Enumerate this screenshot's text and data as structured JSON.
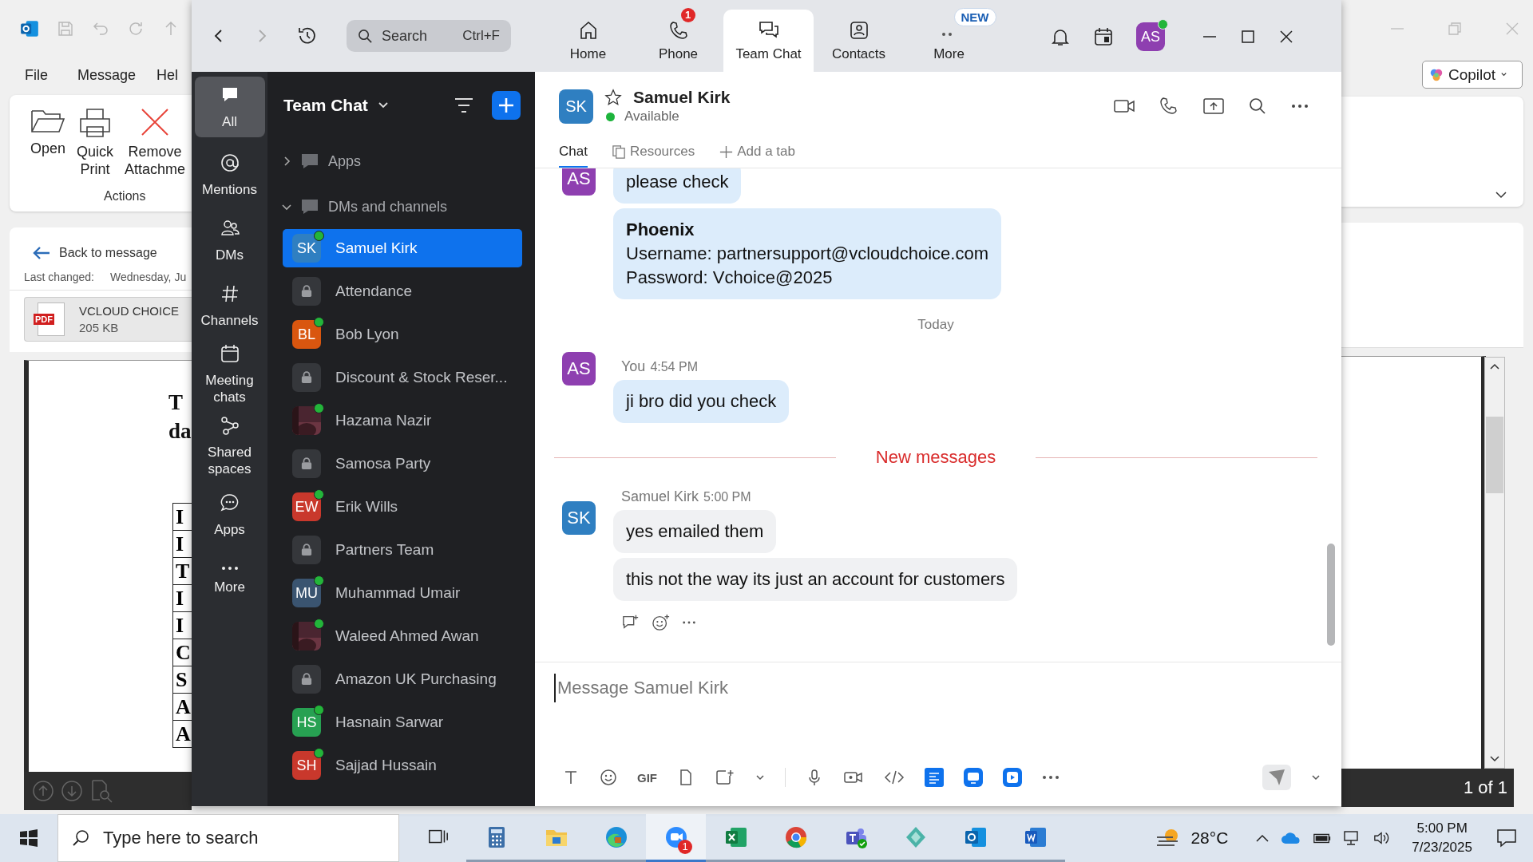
{
  "outlook": {
    "menu": [
      "File",
      "Message",
      "Hel"
    ],
    "ribbon": {
      "buttons": [
        {
          "kind": "open",
          "lines": [
            "Open"
          ]
        },
        {
          "kind": "print",
          "lines": [
            "Quick",
            "Print"
          ]
        },
        {
          "kind": "remove",
          "lines": [
            "Remove",
            "Attachme"
          ]
        }
      ],
      "group_label": "Actions"
    },
    "copilot": "Copilot",
    "back_link": "Back to message",
    "last_changed_label": "Last changed:",
    "last_changed_value": "Wednesday, Ju",
    "attachment": {
      "badge": "PDF",
      "name": "VCLOUD CHOICE",
      "size": "205 KB"
    },
    "document": {
      "heading_lines": [
        "T",
        "da"
      ],
      "table_cells": [
        "I",
        "I",
        "T",
        "I",
        "I",
        "C",
        "S",
        "A",
        "A"
      ]
    },
    "page_indicator": "1 of 1"
  },
  "zoom": {
    "search": {
      "placeholder": "Search",
      "shortcut": "Ctrl+F"
    },
    "nav_tabs": [
      {
        "kind": "home",
        "label": "Home",
        "selected": false
      },
      {
        "kind": "phone",
        "label": "Phone",
        "selected": false,
        "badge": "1"
      },
      {
        "kind": "chat",
        "label": "Team Chat",
        "selected": true
      },
      {
        "kind": "contacts",
        "label": "Contacts",
        "selected": false
      },
      {
        "kind": "more",
        "label": "More",
        "selected": false,
        "tag": "NEW"
      }
    ],
    "user": {
      "initials": "AS",
      "online": true
    },
    "sidebar": [
      {
        "kind": "chat",
        "label": "All",
        "selected": true
      },
      {
        "kind": "at",
        "label": "Mentions",
        "selected": false
      },
      {
        "kind": "people",
        "label": "DMs",
        "selected": false
      },
      {
        "kind": "hash",
        "label": "Channels",
        "selected": false
      },
      {
        "kind": "calendar",
        "label": "Meeting chats",
        "selected": false
      },
      {
        "kind": "share",
        "label": "Shared spaces",
        "selected": false
      },
      {
        "kind": "bubble",
        "label": "Apps",
        "selected": false
      },
      {
        "kind": "dots",
        "label": "More",
        "selected": false
      }
    ],
    "list_title": "Team Chat",
    "sections": [
      {
        "label": "Apps",
        "expanded": false
      },
      {
        "label": "DMs and channels",
        "expanded": true
      }
    ],
    "chats": [
      {
        "kind": "person",
        "name": "Samuel Kirk",
        "initials": "SK",
        "color": "#2f7fc1",
        "online": true,
        "selected": true
      },
      {
        "kind": "channel",
        "name": "Attendance",
        "selected": false
      },
      {
        "kind": "person",
        "name": "Bob Lyon",
        "initials": "BL",
        "color": "#d9560f",
        "online": true,
        "selected": false
      },
      {
        "kind": "channel",
        "name": "Discount & Stock Reser...",
        "selected": false
      },
      {
        "name": "Hazama Nazir",
        "online": true,
        "selected": false
      },
      {
        "kind": "channel",
        "name": "Samosa Party",
        "selected": false
      },
      {
        "kind": "person",
        "name": "Erik Wills",
        "initials": "EW",
        "color": "#c9382c",
        "online": true,
        "selected": false
      },
      {
        "kind": "channel",
        "name": "Partners Team",
        "selected": false
      },
      {
        "kind": "person",
        "name": "Muhammad Umair",
        "initials": "MU",
        "color": "#3a5470",
        "online": true,
        "selected": false
      },
      {
        "name": "Waleed Ahmed Awan",
        "online": true,
        "selected": false
      },
      {
        "kind": "channel",
        "name": "Amazon UK Purchasing",
        "selected": false
      },
      {
        "kind": "person",
        "name": "Hasnain Sarwar",
        "initials": "HS",
        "color": "#27a152",
        "online": true,
        "selected": false
      },
      {
        "kind": "person",
        "name": "Sajjad Hussain",
        "initials": "SH",
        "color": "#c9382c",
        "online": true,
        "selected": false
      }
    ],
    "chat_header": {
      "initials": "SK",
      "name": "Samuel Kirk",
      "status": "Available",
      "online": true
    },
    "chat_tabs": [
      {
        "kind": "plain",
        "label": "Chat",
        "selected": true
      },
      {
        "kind": "files",
        "label": "Resources",
        "selected": false
      },
      {
        "kind": "add",
        "label": "Add a tab",
        "selected": false
      }
    ],
    "messages": [
      {
        "kind": "group",
        "initials": "AS",
        "mine": true,
        "bubbles": [
          {
            "lines": [
              "please check"
            ]
          },
          {
            "title": "Phoenix",
            "lines": [
              "Username: partnersupport@vcloudchoice.com",
              "Password: Vchoice@2025"
            ]
          }
        ]
      },
      {
        "kind": "date",
        "text": "Today"
      },
      {
        "kind": "group",
        "initials": "AS",
        "mine": true,
        "sender": "You",
        "time": "4:54 PM",
        "bubbles": [
          {
            "lines": [
              "ji bro did you check"
            ]
          }
        ]
      },
      {
        "kind": "new",
        "text": "New messages"
      },
      {
        "kind": "group",
        "initials": "SK",
        "mine": false,
        "sender": "Samuel Kirk",
        "time": "5:00 PM",
        "actions": true,
        "bubbles": [
          {
            "lines": [
              "yes emailed them"
            ]
          },
          {
            "lines": [
              "this not the way its just an account for customers"
            ]
          }
        ]
      }
    ],
    "composer": {
      "placeholder": "Message Samuel Kirk",
      "gif_label": "GIF"
    }
  },
  "taskbar": {
    "search_placeholder": "Type here to search",
    "apps": [
      {
        "kind": "taskview"
      },
      {
        "kind": "calculator"
      },
      {
        "kind": "folder"
      },
      {
        "kind": "edge"
      },
      {
        "kind": "zoom",
        "badge": "1",
        "active": true
      },
      {
        "kind": "excel"
      },
      {
        "kind": "chrome"
      },
      {
        "kind": "teams"
      },
      {
        "kind": "diamond"
      },
      {
        "kind": "outlook"
      },
      {
        "kind": "word"
      }
    ],
    "temperature": "28°C",
    "time": "5:00 PM",
    "date": "7/23/2025"
  }
}
